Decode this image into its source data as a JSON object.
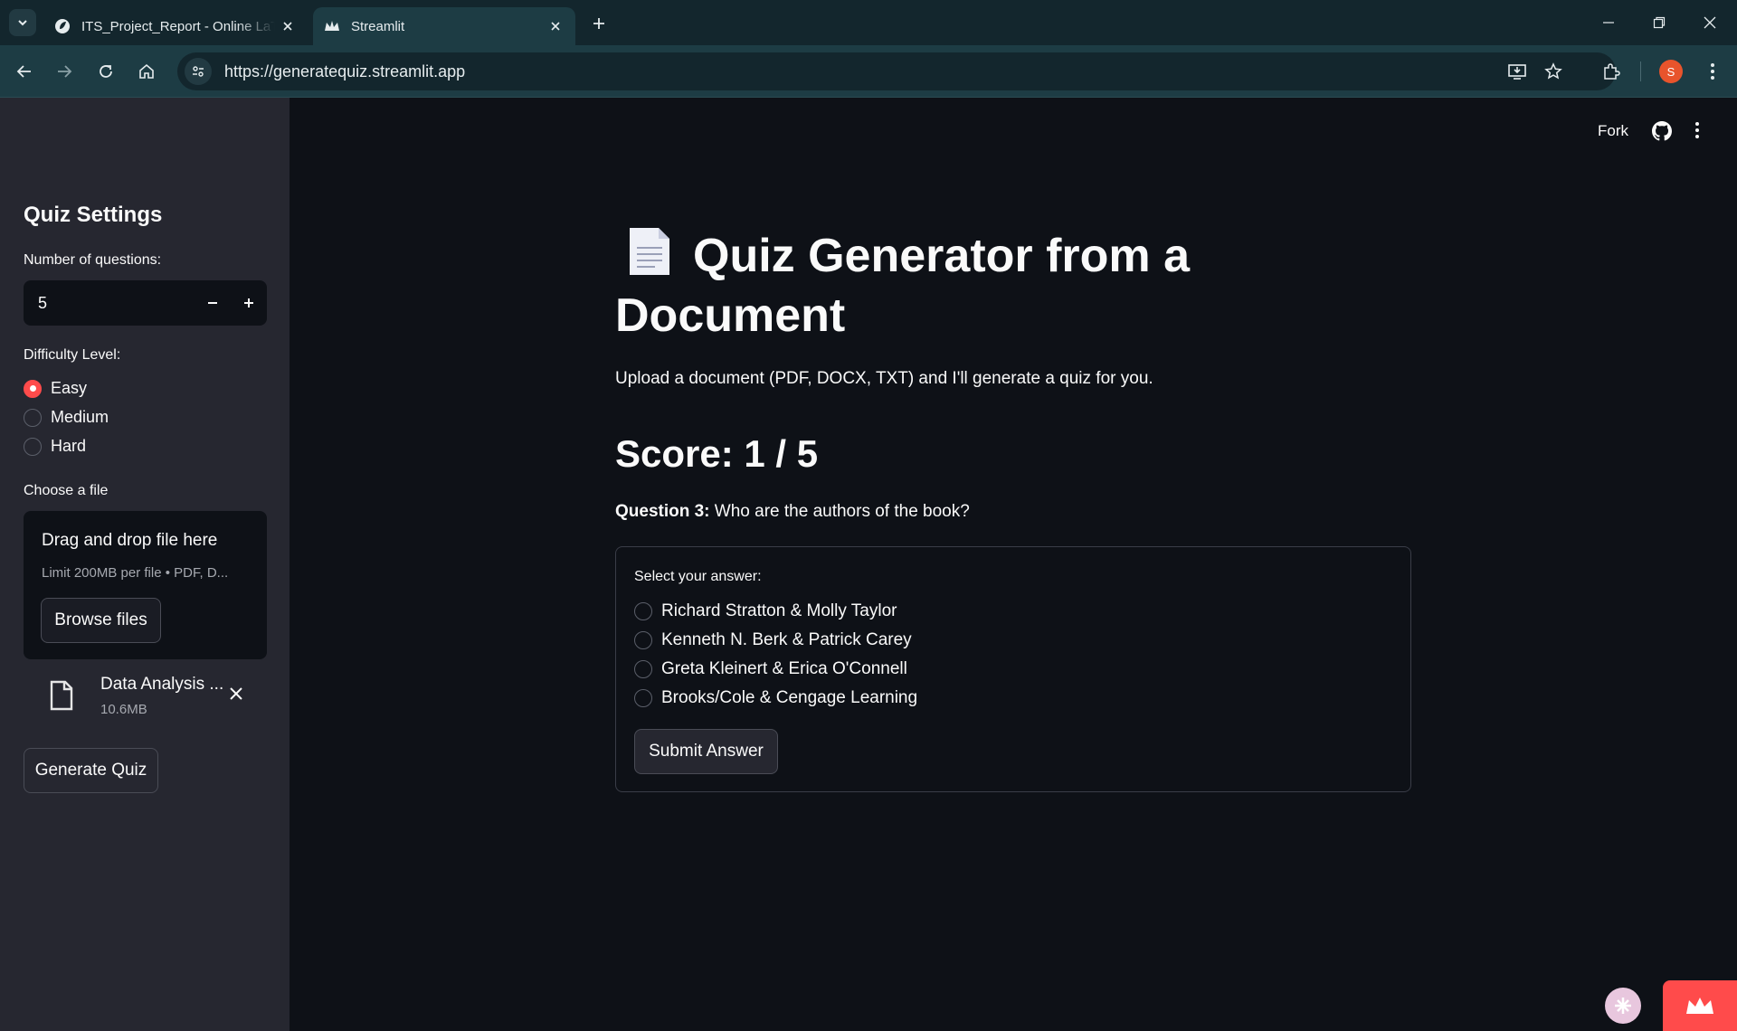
{
  "browser": {
    "tabs": [
      {
        "title": "ITS_Project_Report - Online LaTeX Editor",
        "active": false
      },
      {
        "title": "Streamlit",
        "active": true
      }
    ],
    "url": "https://generatequiz.streamlit.app"
  },
  "header": {
    "fork_label": "Fork"
  },
  "sidebar": {
    "title": "Quiz Settings",
    "num_questions_label": "Number of questions:",
    "num_questions_value": "5",
    "difficulty_label": "Difficulty Level:",
    "difficulty_options": [
      {
        "label": "Easy",
        "selected": true
      },
      {
        "label": "Medium",
        "selected": false
      },
      {
        "label": "Hard",
        "selected": false
      }
    ],
    "file_label": "Choose a file",
    "dropzone_title": "Drag and drop file here",
    "dropzone_limit": "Limit 200MB per file • PDF, D...",
    "browse_label": "Browse files",
    "uploaded_file": {
      "name": "Data Analysis ...",
      "size": "10.6MB"
    },
    "generate_label": "Generate Quiz"
  },
  "main": {
    "title": "Quiz Generator from a Document",
    "description": "Upload a document (PDF, DOCX, TXT) and I'll generate a quiz for you.",
    "score": "Score: 1 / 5",
    "question_prefix": "Question 3:",
    "question_text": " Who are the authors of the book?",
    "answer_label": "Select your answer:",
    "options": [
      "Richard Stratton & Molly Taylor",
      "Kenneth N. Berk & Patrick Carey",
      "Greta Kleinert & Erica O'Connell",
      "Brooks/Cole & Cengage Learning"
    ],
    "submit_label": "Submit Answer"
  },
  "colors": {
    "accent": "#ff4b4b",
    "background": "#0e1117",
    "sidebar": "#262730",
    "browser_frame": "#1d3c44"
  }
}
